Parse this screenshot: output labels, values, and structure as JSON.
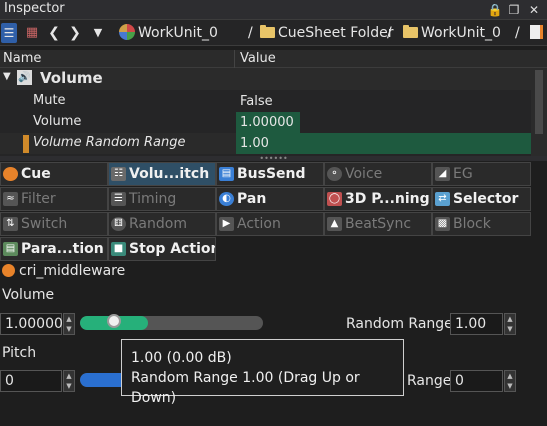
{
  "window": {
    "title": "Inspector",
    "buttons": [
      "lock-icon",
      "restore-icon",
      "close-icon"
    ]
  },
  "toolbar": {
    "breadcrumbs": [
      {
        "icon": "workunit-icon",
        "label": "WorkUnit_0"
      },
      {
        "icon": "folder-icon",
        "label": "CueSheet Folder"
      },
      {
        "icon": "folder-icon",
        "label": "WorkUnit_0"
      }
    ]
  },
  "grid": {
    "headers": {
      "name": "Name",
      "value": "Value"
    },
    "group": {
      "label": "Volume",
      "icon": "speaker-icon"
    },
    "rows": [
      {
        "name": "Mute",
        "value": "False"
      },
      {
        "name": "Volume",
        "value": "1.00000"
      },
      {
        "name": "Volume Random Range",
        "value": "1.00"
      }
    ]
  },
  "tabs": [
    {
      "label": "Cue",
      "icon": "cue-icon",
      "enabled": true,
      "selected": false,
      "color": "#e8832a"
    },
    {
      "label": "Volu...itch",
      "icon": "volume-pitch-icon",
      "enabled": true,
      "selected": true,
      "color": "#6a6a6a"
    },
    {
      "label": "BusSend",
      "icon": "bussend-icon",
      "enabled": true,
      "selected": false,
      "color": "#3a7fd5"
    },
    {
      "label": "Voice",
      "icon": "voice-icon",
      "enabled": false,
      "selected": false,
      "color": "#555555"
    },
    {
      "label": "EG",
      "icon": "eg-icon",
      "enabled": false,
      "selected": false,
      "color": "#555555"
    },
    {
      "label": "Filter",
      "icon": "filter-icon",
      "enabled": false,
      "selected": false,
      "color": "#555555"
    },
    {
      "label": "Timing",
      "icon": "timing-icon",
      "enabled": false,
      "selected": false,
      "color": "#555555"
    },
    {
      "label": "Pan",
      "icon": "pan-icon",
      "enabled": true,
      "selected": false,
      "color": "#3a7fd5"
    },
    {
      "label": "3D P...ning",
      "icon": "3d-panning-icon",
      "enabled": true,
      "selected": false,
      "color": "#c05050"
    },
    {
      "label": "Selector",
      "icon": "selector-icon",
      "enabled": true,
      "selected": false,
      "color": "#5aa0d0"
    },
    {
      "label": "Switch",
      "icon": "switch-icon",
      "enabled": false,
      "selected": false,
      "color": "#555555"
    },
    {
      "label": "Random",
      "icon": "random-icon",
      "enabled": false,
      "selected": false,
      "color": "#555555"
    },
    {
      "label": "Action",
      "icon": "action-icon",
      "enabled": false,
      "selected": false,
      "color": "#555555"
    },
    {
      "label": "BeatSync",
      "icon": "beatsync-icon",
      "enabled": false,
      "selected": false,
      "color": "#555555"
    },
    {
      "label": "Block",
      "icon": "block-icon",
      "enabled": false,
      "selected": false,
      "color": "#555555"
    },
    {
      "label": "Para...tion",
      "icon": "parameter-automation-icon",
      "enabled": true,
      "selected": false,
      "color": "#5c8a5c"
    },
    {
      "label": "Stop Action",
      "icon": "stop-action-icon",
      "enabled": true,
      "selected": false,
      "color": "#3a8a7a"
    }
  ],
  "object": {
    "icon": "cue-icon",
    "name": "cri_middleware"
  },
  "volume": {
    "label": "Volume",
    "value": "1.00000",
    "level": 0.37,
    "fill_color": "#26b07a",
    "random_range_label": "Random Range",
    "random_range_value": "1.00"
  },
  "pitch": {
    "label": "Pitch",
    "value": "0",
    "level": 0.5,
    "fill_color": "#2a6fd0",
    "random_range_label": "Range",
    "random_range_value": "0"
  },
  "tooltip": {
    "line1": "1.00 (0.00 dB)",
    "line2": "Random Range 1.00 (Drag Up or Down)"
  }
}
